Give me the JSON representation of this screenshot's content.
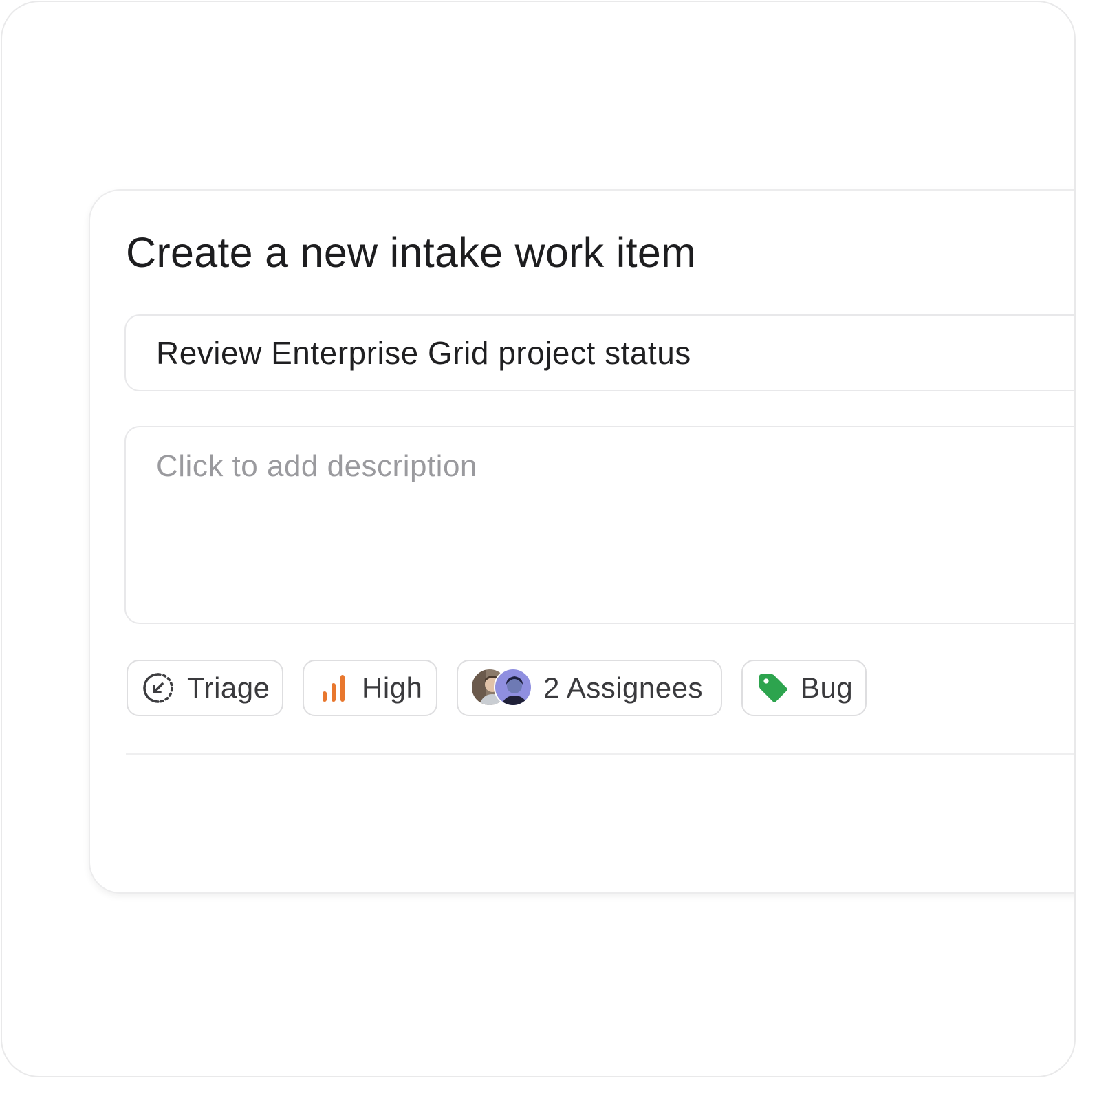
{
  "dialog": {
    "title": "Create a new intake work item"
  },
  "form": {
    "title_value": "Review Enterprise Grid project status",
    "description_placeholder": "Click to add description"
  },
  "properties": {
    "state": {
      "label": "Triage",
      "icon": "triage-state-icon"
    },
    "priority": {
      "label": "High",
      "icon": "priority-bars-icon",
      "color": "#e8772e"
    },
    "assignees": {
      "label": "2 Assignees",
      "icon": "avatar-stack"
    },
    "labels": {
      "label": "Bug",
      "icon": "tag-icon",
      "color": "#2da44e"
    }
  }
}
